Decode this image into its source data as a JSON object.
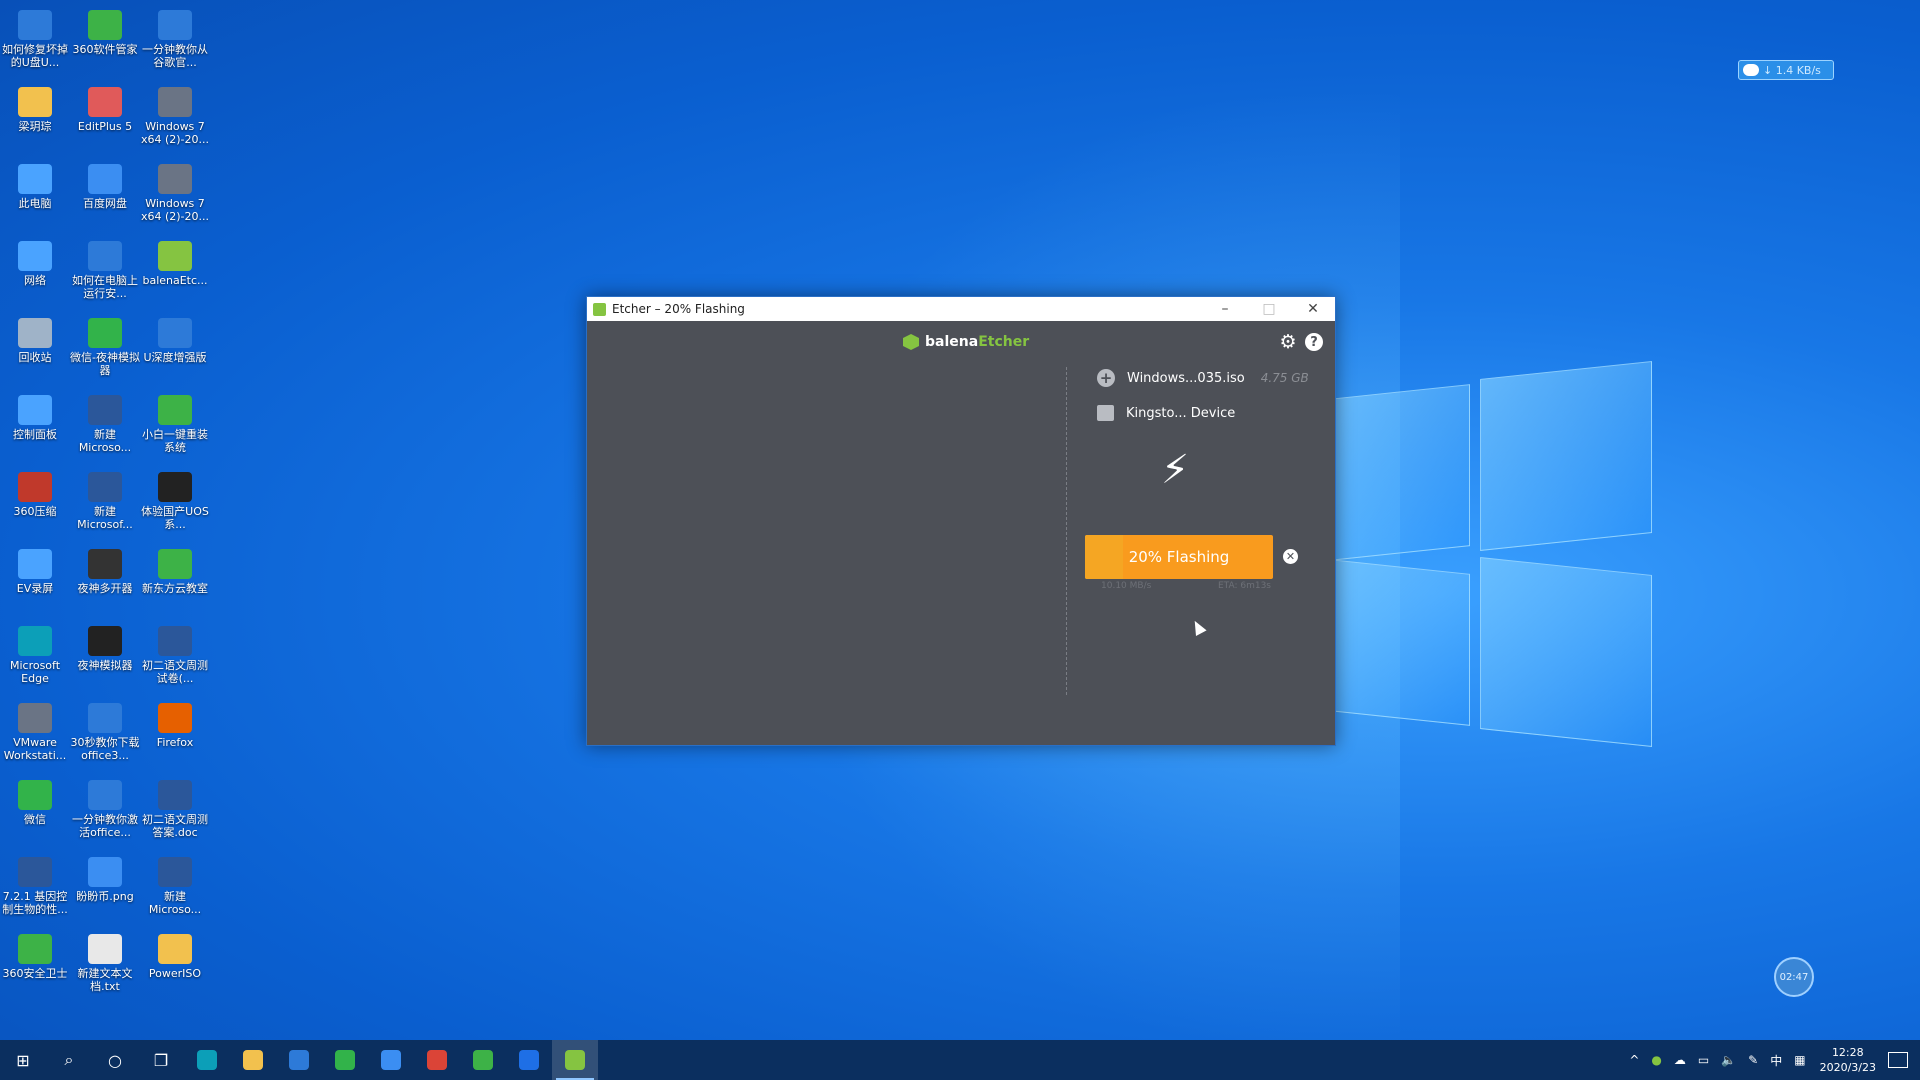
{
  "desktop_icons": [
    {
      "label": "如何修复坏掉的U盘U...",
      "color": "#2d7ad8"
    },
    {
      "label": "360软件管家",
      "color": "#3db247"
    },
    {
      "label": "一分钟教你从谷歌官...",
      "color": "#2d7ad8"
    },
    {
      "label": "梁玥琮",
      "color": "#f2c14e"
    },
    {
      "label": "EditPlus 5",
      "color": "#e05a5a"
    },
    {
      "label": "Windows 7 x64 (2)-20...",
      "color": "#6a7485"
    },
    {
      "label": "此电脑",
      "color": "#4aa3ff"
    },
    {
      "label": "百度网盘",
      "color": "#3b8ef2"
    },
    {
      "label": "Windows 7 x64 (2)-20...",
      "color": "#6a7485"
    },
    {
      "label": "网络",
      "color": "#4aa3ff"
    },
    {
      "label": "如何在电脑上运行安...",
      "color": "#2d7ad8"
    },
    {
      "label": "balenaEtc...",
      "color": "#85c441"
    },
    {
      "label": "回收站",
      "color": "#9fb3c8"
    },
    {
      "label": "微信-夜神模拟器",
      "color": "#32b34a"
    },
    {
      "label": "U深度增强版",
      "color": "#2d7ad8"
    },
    {
      "label": "控制面板",
      "color": "#4aa3ff"
    },
    {
      "label": "新建 Microso...",
      "color": "#2b579a"
    },
    {
      "label": "小白一键重装系统",
      "color": "#3db247"
    },
    {
      "label": "360压缩",
      "color": "#c0392b"
    },
    {
      "label": "新建 Microsof...",
      "color": "#2b579a"
    },
    {
      "label": "体验国产UOS系...",
      "color": "#222222"
    },
    {
      "label": "EV录屏",
      "color": "#4aa3ff"
    },
    {
      "label": "夜神多开器",
      "color": "#333333"
    },
    {
      "label": "新东方云教室",
      "color": "#3db247"
    },
    {
      "label": "Microsoft Edge",
      "color": "#0c9fb8"
    },
    {
      "label": "夜神模拟器",
      "color": "#222222"
    },
    {
      "label": "初二语文周测试卷(...",
      "color": "#2b579a"
    },
    {
      "label": "VMware Workstati...",
      "color": "#6a7485"
    },
    {
      "label": "30秒教你下载office3...",
      "color": "#2d7ad8"
    },
    {
      "label": "Firefox",
      "color": "#e66000"
    },
    {
      "label": "微信",
      "color": "#32b34a"
    },
    {
      "label": "一分钟教你激活office...",
      "color": "#2d7ad8"
    },
    {
      "label": "初二语文周测答案.doc",
      "color": "#2b579a"
    },
    {
      "label": "7.2.1 基因控制生物的性...",
      "color": "#2b579a"
    },
    {
      "label": "盼盼币.png",
      "color": "#3b8ef2"
    },
    {
      "label": "新建 Microso...",
      "color": "#2b579a"
    },
    {
      "label": "360安全卫士",
      "color": "#3db247"
    },
    {
      "label": "新建文本文档.txt",
      "color": "#e8e8e8"
    },
    {
      "label": "PowerISO",
      "color": "#f2c14e"
    }
  ],
  "speed_widget": {
    "text": "↓ 1.4 KB/s"
  },
  "record_badge": {
    "text": "02:47"
  },
  "window": {
    "title": "Etcher – 20% Flashing",
    "brand_prefix": "balena",
    "brand_suffix": "Etcher",
    "image_name": "Windows...035.iso",
    "image_size": "4.75 GB",
    "target_name": "Kingsto... Device",
    "flash_label": "20% Flashing",
    "progress": 0.2,
    "speed": "10.10 MB/s",
    "eta": "ETA: 6m13s"
  },
  "taskbar": {
    "apps": [
      {
        "name": "edge",
        "color": "#0c9fb8"
      },
      {
        "name": "explorer",
        "color": "#f2c14e"
      },
      {
        "name": "store",
        "color": "#2d7ad8"
      },
      {
        "name": "wechat",
        "color": "#32b34a"
      },
      {
        "name": "baidu",
        "color": "#3b8ef2"
      },
      {
        "name": "chrome",
        "color": "#db4437"
      },
      {
        "name": "xiaobai",
        "color": "#3db247"
      },
      {
        "name": "app-blue",
        "color": "#1e6fe6"
      },
      {
        "name": "etcher",
        "color": "#85c441"
      }
    ],
    "ime": "中",
    "time": "12:28",
    "date": "2020/3/23"
  }
}
